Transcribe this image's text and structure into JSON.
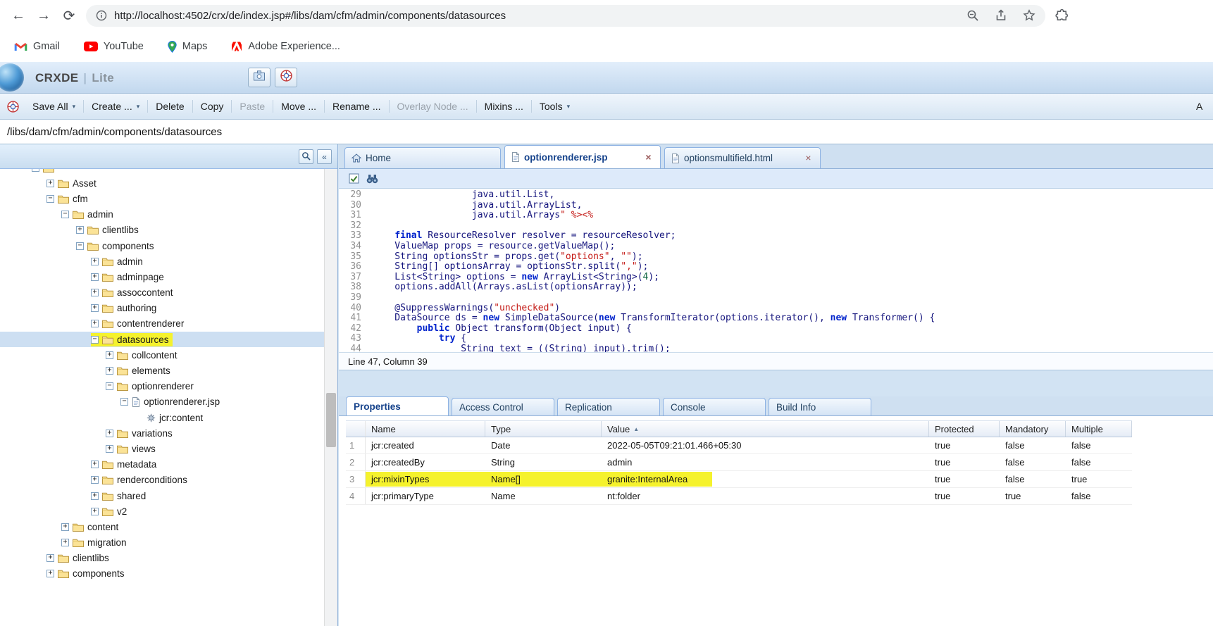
{
  "browser": {
    "nav": {
      "back": "←",
      "forward": "→",
      "reload": "⟳"
    },
    "url": "http://localhost:4502/crx/de/index.jsp#/libs/dam/cfm/admin/components/datasources",
    "bookmarks": [
      {
        "label": "Gmail",
        "icon": "gmail"
      },
      {
        "label": "YouTube",
        "icon": "youtube"
      },
      {
        "label": "Maps",
        "icon": "maps"
      },
      {
        "label": "Adobe Experience...",
        "icon": "adobe"
      }
    ]
  },
  "crx": {
    "brand": "CRXDE",
    "brand_sep": "|",
    "brand_suffix": "Lite",
    "toolbar": [
      {
        "label": "Save All",
        "arrow": true,
        "enabled": true
      },
      {
        "label": "Create ...",
        "arrow": true,
        "enabled": true
      },
      {
        "label": "Delete",
        "arrow": false,
        "enabled": true
      },
      {
        "label": "Copy",
        "arrow": false,
        "enabled": true
      },
      {
        "label": "Paste",
        "arrow": false,
        "enabled": false
      },
      {
        "label": "Move ...",
        "arrow": false,
        "enabled": true
      },
      {
        "label": "Rename ...",
        "arrow": false,
        "enabled": true
      },
      {
        "label": "Overlay Node ...",
        "arrow": false,
        "enabled": false
      },
      {
        "label": "Mixins ...",
        "arrow": false,
        "enabled": true
      },
      {
        "label": "Tools",
        "arrow": true,
        "enabled": true
      }
    ],
    "toolbar_right_clipped": "A",
    "path": "/libs/dam/cfm/admin/components/datasources"
  },
  "tree": {
    "items": [
      {
        "label": "",
        "depth": 1,
        "expander": "-",
        "icon": "folder"
      },
      {
        "label": "Asset",
        "depth": 2,
        "expander": "+",
        "icon": "folder"
      },
      {
        "label": "cfm",
        "depth": 2,
        "expander": "-",
        "icon": "folder"
      },
      {
        "label": "admin",
        "depth": 3,
        "expander": "-",
        "icon": "folder"
      },
      {
        "label": "clientlibs",
        "depth": 4,
        "expander": "+",
        "icon": "folder"
      },
      {
        "label": "components",
        "depth": 4,
        "expander": "-",
        "icon": "folder"
      },
      {
        "label": "admin",
        "depth": 5,
        "expander": "+",
        "icon": "folder"
      },
      {
        "label": "adminpage",
        "depth": 5,
        "expander": "+",
        "icon": "folder"
      },
      {
        "label": "assoccontent",
        "depth": 5,
        "expander": "+",
        "icon": "folder"
      },
      {
        "label": "authoring",
        "depth": 5,
        "expander": "+",
        "icon": "folder"
      },
      {
        "label": "contentrenderer",
        "depth": 5,
        "expander": "+",
        "icon": "folder"
      },
      {
        "label": "datasources",
        "depth": 5,
        "expander": "-",
        "icon": "folder",
        "selected": true,
        "highlighted": true
      },
      {
        "label": "collcontent",
        "depth": 6,
        "expander": "+",
        "icon": "folder"
      },
      {
        "label": "elements",
        "depth": 6,
        "expander": "+",
        "icon": "folder"
      },
      {
        "label": "optionrenderer",
        "depth": 6,
        "expander": "-",
        "icon": "folder"
      },
      {
        "label": "optionrenderer.jsp",
        "depth": 7,
        "expander": "-",
        "icon": "file"
      },
      {
        "label": "jcr:content",
        "depth": 8,
        "expander": "none",
        "icon": "content"
      },
      {
        "label": "variations",
        "depth": 6,
        "expander": "+",
        "icon": "folder"
      },
      {
        "label": "views",
        "depth": 6,
        "expander": "+",
        "icon": "folder"
      },
      {
        "label": "metadata",
        "depth": 5,
        "expander": "+",
        "icon": "folder"
      },
      {
        "label": "renderconditions",
        "depth": 5,
        "expander": "+",
        "icon": "folder"
      },
      {
        "label": "shared",
        "depth": 5,
        "expander": "+",
        "icon": "folder"
      },
      {
        "label": "v2",
        "depth": 5,
        "expander": "+",
        "icon": "folder"
      },
      {
        "label": "content",
        "depth": 3,
        "expander": "+",
        "icon": "folder"
      },
      {
        "label": "migration",
        "depth": 3,
        "expander": "+",
        "icon": "folder"
      },
      {
        "label": "clientlibs",
        "depth": 2,
        "expander": "+",
        "icon": "folder"
      },
      {
        "label": "components",
        "depth": 2,
        "expander": "+",
        "icon": "folder"
      }
    ]
  },
  "editor": {
    "tabs": [
      {
        "label": "Home",
        "icon": "home",
        "closable": false,
        "active": false
      },
      {
        "label": "optionrenderer.jsp",
        "icon": "file",
        "closable": true,
        "active": true
      },
      {
        "label": "optionsmultifield.html",
        "icon": "file",
        "closable": true,
        "active": false
      }
    ],
    "status": "Line 47, Column 39",
    "lines": [
      {
        "no": "29",
        "segs": [
          [
            "p",
            "                  java.util.List,"
          ]
        ]
      },
      {
        "no": "30",
        "segs": [
          [
            "p",
            "                  java.util.ArrayList,"
          ]
        ]
      },
      {
        "no": "31",
        "segs": [
          [
            "p",
            "                  java.util.Arrays"
          ],
          [
            "s",
            "\" %><%"
          ]
        ]
      },
      {
        "no": "32",
        "segs": []
      },
      {
        "no": "33",
        "segs": [
          [
            "p",
            "    "
          ],
          [
            "k",
            "final"
          ],
          [
            "p",
            " ResourceResolver resolver = resourceResolver;"
          ]
        ]
      },
      {
        "no": "34",
        "segs": [
          [
            "p",
            "    ValueMap props = resource.getValueMap();"
          ]
        ]
      },
      {
        "no": "35",
        "segs": [
          [
            "p",
            "    String optionsStr = props.get("
          ],
          [
            "s",
            "\"options\""
          ],
          [
            "p",
            ", "
          ],
          [
            "s",
            "\"\""
          ],
          [
            "p",
            ");"
          ]
        ]
      },
      {
        "no": "36",
        "segs": [
          [
            "p",
            "    String[] optionsArray = optionsStr.split("
          ],
          [
            "s",
            "\",\""
          ],
          [
            "p",
            ");"
          ]
        ]
      },
      {
        "no": "37",
        "segs": [
          [
            "p",
            "    List<String> options = "
          ],
          [
            "k",
            "new"
          ],
          [
            "p",
            " ArrayList<String>("
          ],
          [
            "n",
            "4"
          ],
          [
            "p",
            ");"
          ]
        ]
      },
      {
        "no": "38",
        "segs": [
          [
            "p",
            "    options.addAll(Arrays.asList(optionsArray));"
          ]
        ]
      },
      {
        "no": "39",
        "segs": []
      },
      {
        "no": "40",
        "segs": [
          [
            "p",
            "    @SuppressWarnings("
          ],
          [
            "s",
            "\"unchecked\""
          ],
          [
            "p",
            ")"
          ]
        ]
      },
      {
        "no": "41",
        "segs": [
          [
            "p",
            "    DataSource ds = "
          ],
          [
            "k",
            "new"
          ],
          [
            "p",
            " SimpleDataSource("
          ],
          [
            "k",
            "new"
          ],
          [
            "p",
            " TransformIterator(options.iterator(), "
          ],
          [
            "k",
            "new"
          ],
          [
            "p",
            " Transformer() {"
          ]
        ]
      },
      {
        "no": "42",
        "segs": [
          [
            "p",
            "        "
          ],
          [
            "k",
            "public"
          ],
          [
            "p",
            " Object transform(Object input) {"
          ]
        ]
      },
      {
        "no": "43",
        "segs": [
          [
            "p",
            "            "
          ],
          [
            "k",
            "try"
          ],
          [
            "p",
            " {"
          ]
        ]
      },
      {
        "no": "44",
        "segs": [
          [
            "p",
            "                String text = ((String) input).trim();"
          ]
        ]
      }
    ]
  },
  "bottom_panel": {
    "tabs": [
      {
        "label": "Properties",
        "active": true
      },
      {
        "label": "Access Control",
        "active": false
      },
      {
        "label": "Replication",
        "active": false
      },
      {
        "label": "Console",
        "active": false
      },
      {
        "label": "Build Info",
        "active": false
      }
    ],
    "grid": {
      "columns": [
        "Name",
        "Type",
        "Value",
        "Protected",
        "Mandatory",
        "Multiple"
      ],
      "sorted_by": "Value",
      "sort_dir": "asc",
      "rows": [
        {
          "n": "1",
          "name": "jcr:created",
          "type": "Date",
          "value": "2022-05-05T09:21:01.466+05:30",
          "protected": "true",
          "mandatory": "false",
          "multiple": "false"
        },
        {
          "n": "2",
          "name": "jcr:createdBy",
          "type": "String",
          "value": "admin",
          "protected": "true",
          "mandatory": "false",
          "multiple": "false"
        },
        {
          "n": "3",
          "name": "jcr:mixinTypes",
          "type": "Name[]",
          "value": "granite:InternalArea",
          "protected": "true",
          "mandatory": "false",
          "multiple": "true",
          "highlighted": true
        },
        {
          "n": "4",
          "name": "jcr:primaryType",
          "type": "Name",
          "value": "nt:folder",
          "protected": "true",
          "mandatory": "true",
          "multiple": "false"
        }
      ]
    }
  }
}
